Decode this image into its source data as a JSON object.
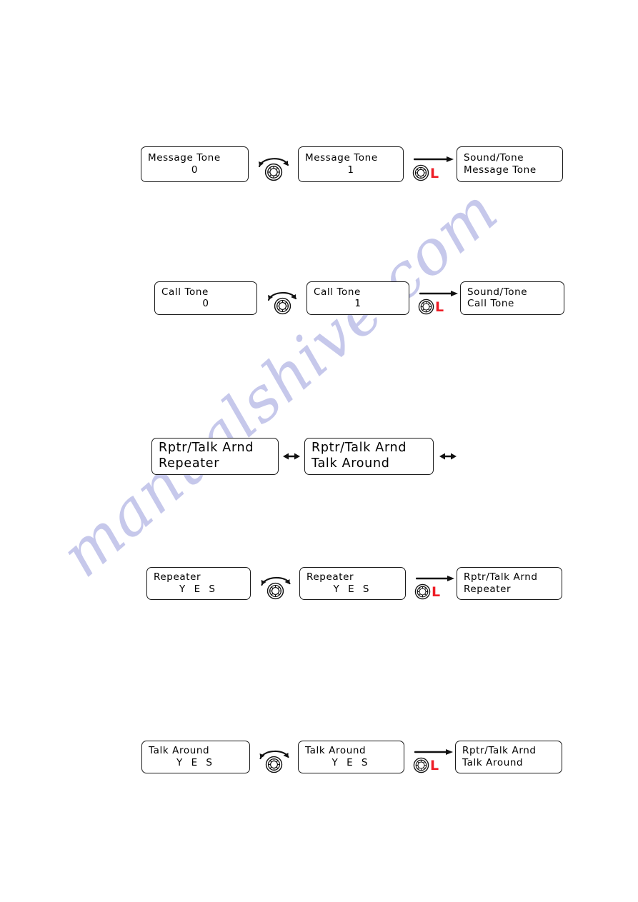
{
  "page": {
    "watermark": "manualshive.com",
    "background_color": "#ffffff",
    "watermark_color": "#c3c6ea",
    "long_press_color": "#ee1c25"
  },
  "icons": {
    "knob": "rotary-knob-icon",
    "rotate_arrow": "rotate-arrow-icon",
    "right_arrow": "arrow-right-icon",
    "double_arrow": "arrow-left-right-icon",
    "long_press": "L"
  },
  "rows": [
    {
      "id": "message-tone",
      "screens": [
        {
          "line1": "Message Tone",
          "line2": "0",
          "align1": "left",
          "align2": "center",
          "size": "small"
        },
        {
          "line1": "Message Tone",
          "line2": "1",
          "align1": "left",
          "align2": "center",
          "size": "small"
        },
        {
          "line1": "Sound/Tone",
          "line2": "Message Tone",
          "align1": "left",
          "align2": "left",
          "size": "small"
        }
      ],
      "connectors": [
        "knob-rotate",
        "knob-long-press"
      ]
    },
    {
      "id": "call-tone",
      "screens": [
        {
          "line1": "Call Tone",
          "line2": "0",
          "align1": "left",
          "align2": "center",
          "size": "small"
        },
        {
          "line1": "Call Tone",
          "line2": "1",
          "align1": "left",
          "align2": "center",
          "size": "small"
        },
        {
          "line1": "Sound/Tone",
          "line2": "Call Tone",
          "align1": "left",
          "align2": "left",
          "size": "small"
        }
      ],
      "connectors": [
        "knob-rotate",
        "knob-long-press"
      ]
    },
    {
      "id": "rptr-talk-arnd",
      "screens": [
        {
          "line1": "Rptr/Talk Arnd",
          "line2": "Repeater",
          "align1": "left",
          "align2": "left",
          "size": "large"
        },
        {
          "line1": "Rptr/Talk Arnd",
          "line2": "Talk Around",
          "align1": "left",
          "align2": "left",
          "size": "large"
        }
      ],
      "connectors": [
        "double-arrow",
        "double-arrow"
      ]
    },
    {
      "id": "repeater",
      "screens": [
        {
          "line1": "Repeater",
          "line2": "Y E S",
          "align1": "left",
          "align2": "center",
          "size": "small"
        },
        {
          "line1": "Repeater",
          "line2": "Y E S",
          "align1": "left",
          "align2": "center",
          "size": "small"
        },
        {
          "line1": "Rptr/Talk Arnd",
          "line2": "Repeater",
          "align1": "left",
          "align2": "left",
          "size": "small"
        }
      ],
      "connectors": [
        "knob-rotate",
        "knob-long-press"
      ]
    },
    {
      "id": "talk-around",
      "screens": [
        {
          "line1": "Talk Around",
          "line2": "Y E S",
          "align1": "left",
          "align2": "center",
          "size": "small"
        },
        {
          "line1": "Talk Around",
          "line2": "Y E S",
          "align1": "left",
          "align2": "center",
          "size": "small"
        },
        {
          "line1": "Rptr/Talk Arnd",
          "line2": "Talk Around",
          "align1": "left",
          "align2": "left",
          "size": "small"
        }
      ],
      "connectors": [
        "knob-rotate",
        "knob-long-press"
      ]
    }
  ]
}
